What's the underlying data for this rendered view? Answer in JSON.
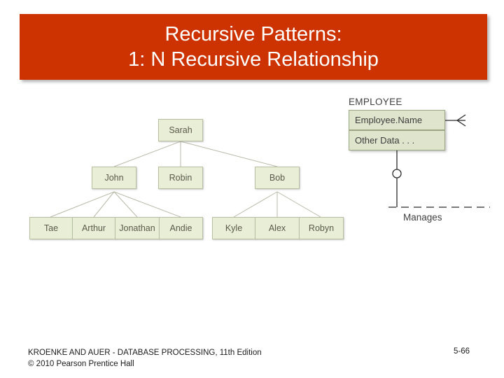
{
  "slide": {
    "title": "Recursive Patterns:\n1: N Recursive Relationship",
    "title_bg_color": "#cc3300",
    "title_text_color": "#ffffff"
  },
  "tree": {
    "node_fill_color": "#e9eed7",
    "node_border_color": "#b6bfa0",
    "levels": [
      {
        "nodes": [
          {
            "label": "Sarah"
          }
        ]
      },
      {
        "nodes": [
          {
            "label": "John"
          },
          {
            "label": "Robin"
          },
          {
            "label": "Bob"
          }
        ]
      },
      {
        "nodes": [
          {
            "label": "Tae"
          },
          {
            "label": "Arthur"
          },
          {
            "label": "Jonathan"
          },
          {
            "label": "Andie"
          },
          {
            "label": "Kyle"
          },
          {
            "label": "Alex"
          },
          {
            "label": "Robyn"
          }
        ]
      }
    ]
  },
  "entity": {
    "title": "EMPLOYEE",
    "attributes": [
      "Employee.Name",
      "Other Data  . . ."
    ],
    "relationship_label": "Manages",
    "fill_color": "#dfe5cd",
    "border_color": "#9aa682"
  },
  "footer": {
    "credit": "KROENKE AND AUER - DATABASE PROCESSING, 11th Edition\n© 2010 Pearson Prentice Hall",
    "page_number": "5-66"
  }
}
